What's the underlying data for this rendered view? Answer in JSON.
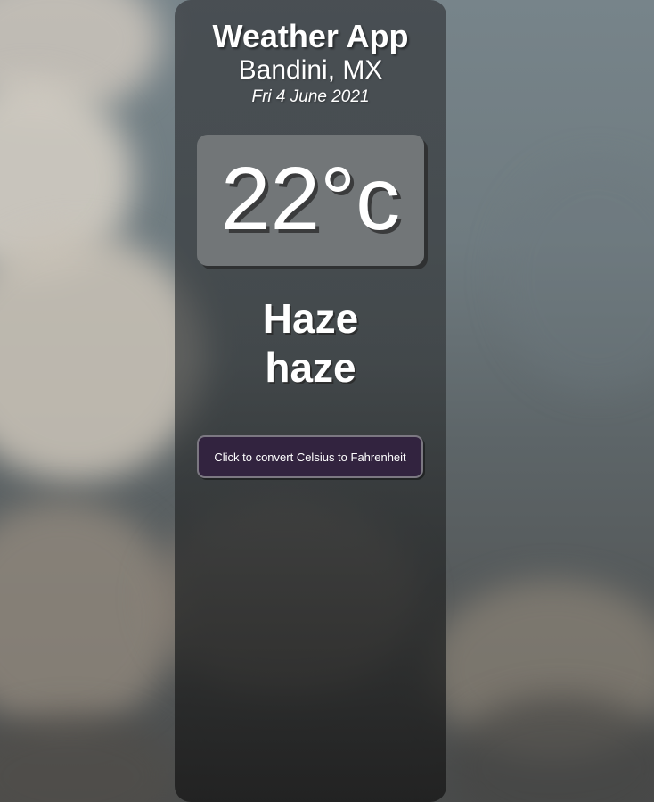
{
  "app": {
    "title": "Weather App"
  },
  "location": {
    "city": "Bandini, MX"
  },
  "date": {
    "text": "Fri 4 June 2021"
  },
  "temperature": {
    "display": "22°c",
    "value": 22,
    "unit": "c"
  },
  "condition": {
    "main": "Haze",
    "description": "haze"
  },
  "actions": {
    "convert_label": "Click to convert Celsius to Fahrenheit"
  },
  "colors": {
    "button_background": "#32233f",
    "panel_background": "#3c3f42",
    "temp_box_background": "#76797c"
  }
}
